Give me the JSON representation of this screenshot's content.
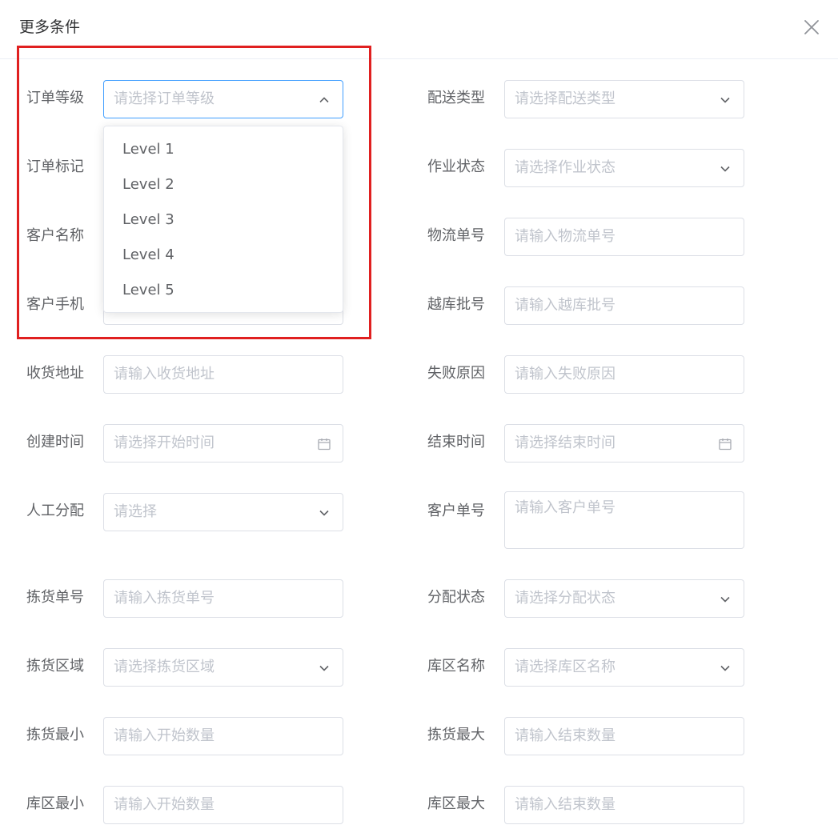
{
  "dialog": {
    "title": "更多条件",
    "close_icon": "close-icon"
  },
  "fields": {
    "order_level": {
      "label": "订单等级",
      "placeholder": "请选择订单等级"
    },
    "delivery_type": {
      "label": "配送类型",
      "placeholder": "请选择配送类型"
    },
    "order_tag": {
      "label": "订单标记"
    },
    "job_status": {
      "label": "作业状态",
      "placeholder": "请选择作业状态"
    },
    "customer_name": {
      "label": "客户名称"
    },
    "logistics_no": {
      "label": "物流单号",
      "placeholder": "请输入物流单号"
    },
    "customer_phone": {
      "label": "客户手机"
    },
    "cross_dock_batch": {
      "label": "越库批号",
      "placeholder": "请输入越库批号"
    },
    "shipping_address": {
      "label": "收货地址",
      "placeholder": "请输入收货地址"
    },
    "failure_reason": {
      "label": "失败原因",
      "placeholder": "请输入失败原因"
    },
    "create_time": {
      "label": "创建时间",
      "placeholder": "请选择开始时间"
    },
    "end_time": {
      "label": "结束时间",
      "placeholder": "请选择结束时间"
    },
    "manual_assign": {
      "label": "人工分配",
      "placeholder": "请选择"
    },
    "customer_order_no": {
      "label": "客户单号",
      "placeholder": "请输入客户单号"
    },
    "picking_no": {
      "label": "拣货单号",
      "placeholder": "请输入拣货单号"
    },
    "assign_status": {
      "label": "分配状态",
      "placeholder": "请选择分配状态"
    },
    "picking_area": {
      "label": "拣货区域",
      "placeholder": "请选择拣货区域"
    },
    "warehouse_area_name": {
      "label": "库区名称",
      "placeholder": "请选择库区名称"
    },
    "picking_min": {
      "label": "拣货最小",
      "placeholder": "请输入开始数量"
    },
    "picking_max": {
      "label": "拣货最大",
      "placeholder": "请输入结束数量"
    },
    "area_min": {
      "label": "库区最小",
      "placeholder": "请输入开始数量"
    },
    "area_max": {
      "label": "库区最大",
      "placeholder": "请输入结束数量"
    }
  },
  "order_level_dropdown": {
    "options": [
      "Level 1",
      "Level 2",
      "Level 3",
      "Level 4",
      "Level 5"
    ]
  },
  "colors": {
    "focus_border": "#409eff",
    "placeholder": "#c0c4cc",
    "label": "#606266",
    "highlight_box": "#e02020"
  }
}
